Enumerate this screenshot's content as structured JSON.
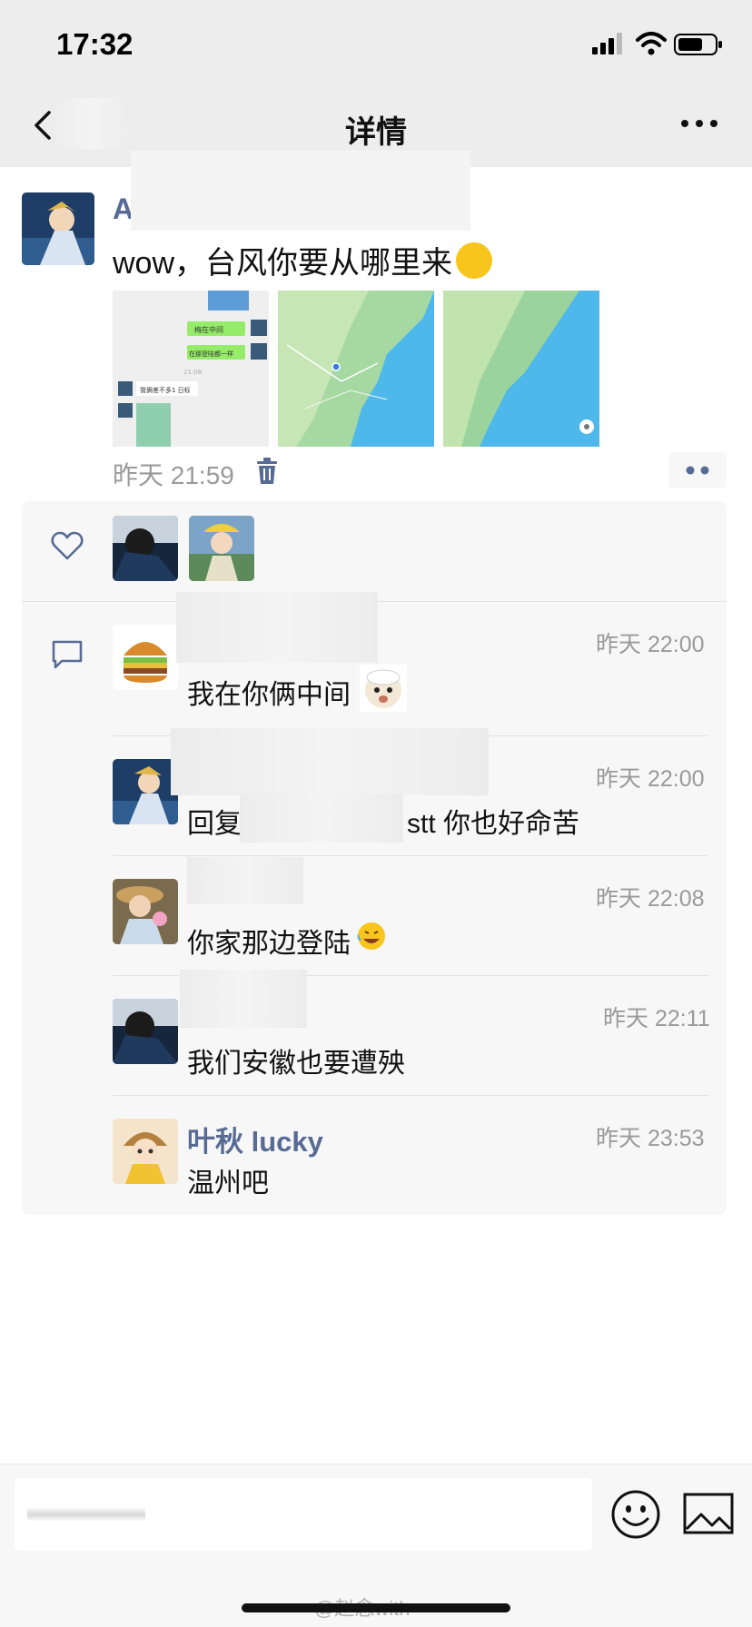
{
  "status": {
    "time": "17:32"
  },
  "nav": {
    "title": "详情"
  },
  "post": {
    "author_initial": "A",
    "text": "wow，台风你要从哪里来",
    "time": "昨天 21:59",
    "images": [
      {
        "kind": "chat-screenshot",
        "bubble_1": "梅在中间",
        "bubble_2": "在那登陆都一样",
        "time_text": "21:08",
        "bubble_3": "我俩差不多1 日标"
      },
      {
        "kind": "map"
      },
      {
        "kind": "map"
      }
    ]
  },
  "comments": [
    {
      "name": "",
      "text": "我在你俩中间",
      "time": "昨天 22:00"
    },
    {
      "name": "",
      "reply_prefix": "回复",
      "text": "stt 你也好命苦",
      "time": "昨天 22:00"
    },
    {
      "name": "",
      "text": "你家那边登陆",
      "time": "昨天 22:08"
    },
    {
      "name": "",
      "text": "我们安徽也要遭殃",
      "time": "昨天 22:11"
    },
    {
      "name": "叶秋 lucky",
      "text": "温州吧",
      "time": "昨天 23:53"
    }
  ],
  "input": {
    "placeholder": "评论"
  },
  "watermark": "@赵念with",
  "colors": {
    "link": "#576b95",
    "panel": "#f7f7f7",
    "nav": "#ededed"
  }
}
